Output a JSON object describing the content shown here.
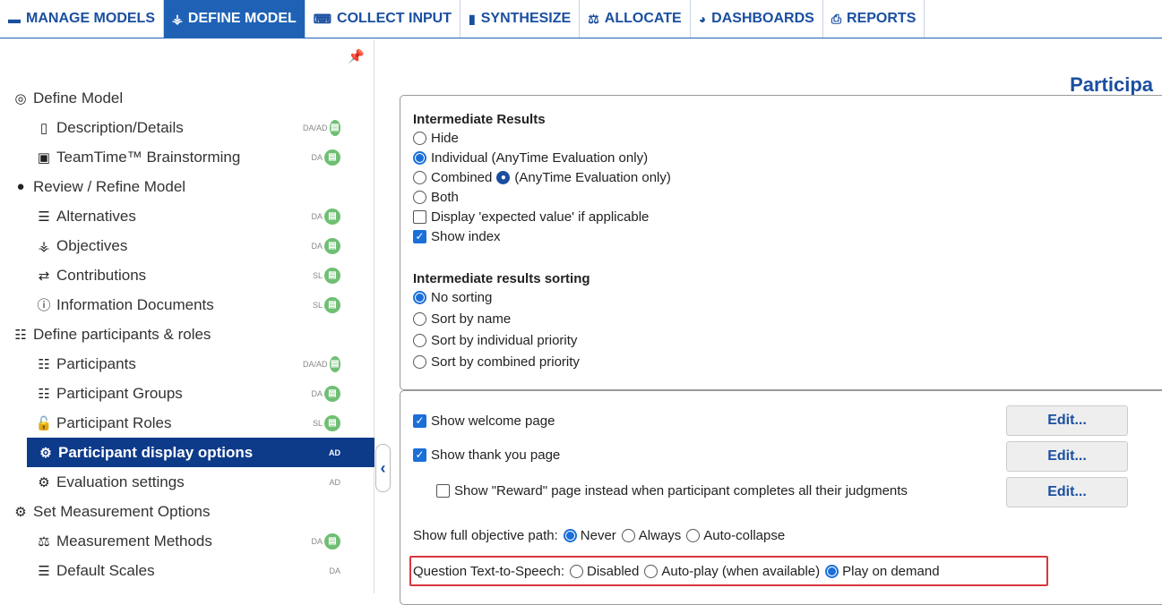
{
  "topnav": {
    "tabs": [
      {
        "label": "MANAGE MODELS",
        "icon": "folder-open-icon",
        "active": false
      },
      {
        "label": "DEFINE MODEL",
        "icon": "hierarchy-icon",
        "active": true
      },
      {
        "label": "COLLECT INPUT",
        "icon": "keyboard-icon",
        "active": false
      },
      {
        "label": "SYNTHESIZE",
        "icon": "bar-chart-icon",
        "active": false
      },
      {
        "label": "ALLOCATE",
        "icon": "scales-icon",
        "active": false
      },
      {
        "label": "DASHBOARDS",
        "icon": "gauge-icon",
        "active": false
      },
      {
        "label": "REPORTS",
        "icon": "printer-icon",
        "active": false
      }
    ]
  },
  "sidebar": {
    "items": [
      {
        "label": "Define Model",
        "badge": "",
        "dot": false
      },
      {
        "label": "Description/Details",
        "badge": "DA/AD",
        "dot": true
      },
      {
        "label": "TeamTime™ Brainstorming",
        "badge": "DA",
        "dot": true
      },
      {
        "label": "Review / Refine Model",
        "badge": "",
        "dot": false
      },
      {
        "label": "Alternatives",
        "badge": "DA",
        "dot": true
      },
      {
        "label": "Objectives",
        "badge": "DA",
        "dot": true
      },
      {
        "label": "Contributions",
        "badge": "SL",
        "dot": true
      },
      {
        "label": "Information Documents",
        "badge": "SL",
        "dot": true
      },
      {
        "label": "Define participants & roles",
        "badge": "",
        "dot": false
      },
      {
        "label": "Participants",
        "badge": "DA/AD",
        "dot": true
      },
      {
        "label": "Participant Groups",
        "badge": "DA",
        "dot": true
      },
      {
        "label": "Participant Roles",
        "badge": "SL",
        "dot": true
      },
      {
        "label": "Participant display options",
        "badge": "AD",
        "dot": false
      },
      {
        "label": "Evaluation settings",
        "badge": "AD",
        "dot": false
      },
      {
        "label": "Set Measurement Options",
        "badge": "",
        "dot": false
      },
      {
        "label": "Measurement Methods",
        "badge": "DA",
        "dot": true
      },
      {
        "label": "Default Scales",
        "badge": "DA",
        "dot": false
      }
    ]
  },
  "main": {
    "title": "Participa",
    "intermediate": {
      "heading": "Intermediate Results",
      "options": [
        "Hide",
        "Individual (AnyTime Evaluation only)",
        "Combined",
        "(AnyTime Evaluation only)",
        "Both"
      ],
      "selected": "Individual (AnyTime Evaluation only)",
      "expected_value": "Display 'expected value' if applicable",
      "show_index": "Show index"
    },
    "sorting": {
      "heading": "Intermediate results sorting",
      "options": [
        "No sorting",
        "Sort by name",
        "Sort by individual priority",
        "Sort by combined priority"
      ],
      "selected": "No sorting"
    },
    "pages": {
      "welcome": "Show welcome page",
      "thankyou": "Show thank you page",
      "reward": "Show \"Reward\" page instead when participant completes all their judgments",
      "edit_label": "Edit..."
    },
    "path": {
      "label": "Show full objective path:",
      "options": [
        "Never",
        "Always",
        "Auto-collapse"
      ],
      "selected": "Never"
    },
    "tts": {
      "label": "Question Text-to-Speech:",
      "options": [
        "Disabled",
        "Auto-play (when available)",
        "Play on demand"
      ],
      "selected": "Play on demand"
    }
  }
}
